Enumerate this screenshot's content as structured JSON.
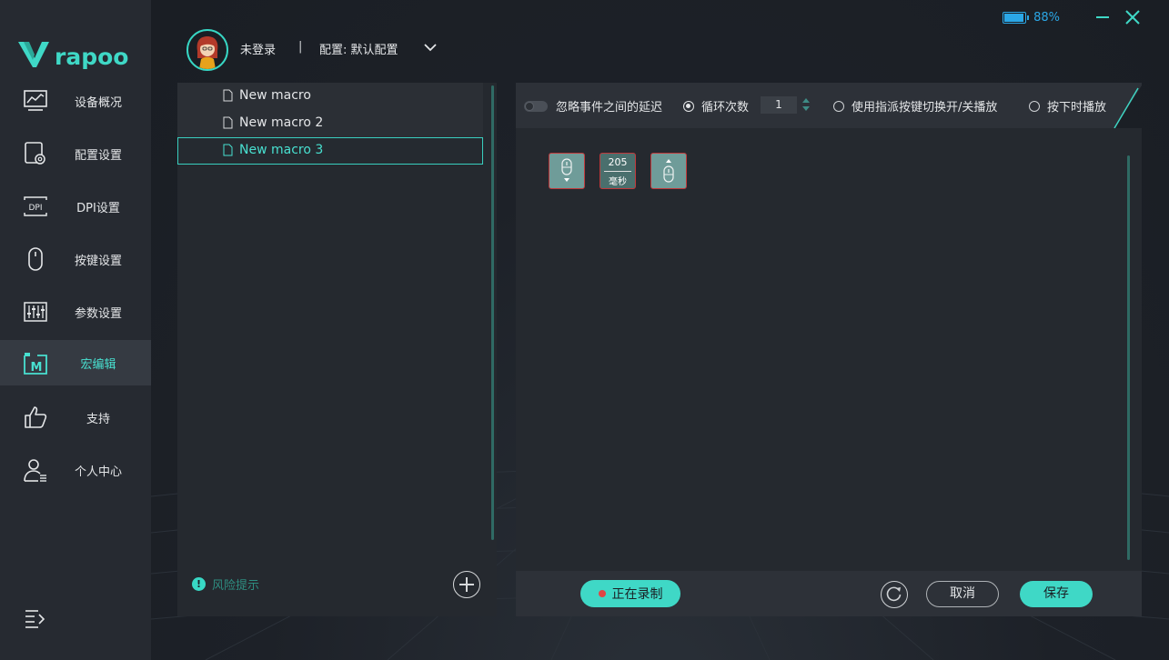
{
  "header": {
    "battery_text": "88%",
    "battery_level": 0.88,
    "user_name": "未登录",
    "separator": "|",
    "profile_label": "配置: 默认配置"
  },
  "sidebar": {
    "brand": "rapoo",
    "items": [
      {
        "label": "设备概况",
        "icon": "monitor-chart-icon"
      },
      {
        "label": "配置设置",
        "icon": "config-gear-icon"
      },
      {
        "label": "DPI设置",
        "icon": "dpi-icon"
      },
      {
        "label": "按键设置",
        "icon": "mouse-icon"
      },
      {
        "label": "参数设置",
        "icon": "sliders-icon"
      },
      {
        "label": "宏编辑",
        "icon": "macro-icon"
      },
      {
        "label": "支持",
        "icon": "thumbs-up-icon"
      },
      {
        "label": "个人中心",
        "icon": "user-icon"
      }
    ],
    "active_index": 5
  },
  "macro_list": {
    "items": [
      "New macro",
      "New macro 2",
      "New macro 3"
    ],
    "selected_index": 2,
    "risk_label": "风险提示",
    "risk_icon_text": "!"
  },
  "options": {
    "ignore_delay_label": "忽略事件之间的延迟",
    "loop_label": "循环次数",
    "loop_value": "1",
    "toggle_mode_label": "使用指派按键切换开/关播放",
    "hold_mode_label": "按下时播放"
  },
  "events": [
    {
      "type": "mouse-down",
      "icon": "mouse-down-icon"
    },
    {
      "type": "delay",
      "value": "205",
      "unit": "毫秒"
    },
    {
      "type": "mouse-up",
      "icon": "mouse-up-icon"
    }
  ],
  "actions": {
    "recording_label": "正在录制",
    "cancel_label": "取消",
    "save_label": "保存"
  },
  "colors": {
    "accent": "#3fd8c6",
    "battery": "#2ba7e6",
    "event_border": "#c0393b"
  }
}
